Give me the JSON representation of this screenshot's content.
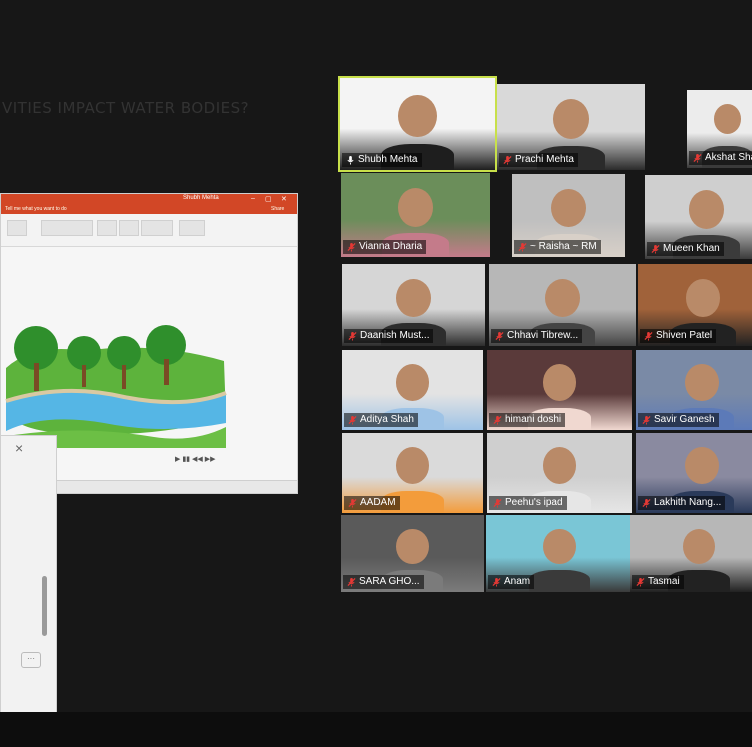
{
  "share": {
    "window_user": "Shubh Mehta",
    "tell_me": "Tell me what you want to do",
    "share_label": "Share",
    "slide_title": "VITIES IMPACT WATER BODIES?"
  },
  "side_panel": {
    "close_icon": "×",
    "more_label": "···"
  },
  "gallery": {
    "participants": [
      {
        "name": "Shubh Mehta",
        "muted": false
      },
      {
        "name": "Prachi Mehta",
        "muted": true
      },
      {
        "name": "Akshat Shah",
        "muted": true
      },
      {
        "name": "Vianna Dharia",
        "muted": true
      },
      {
        "name": "~ Raisha ~ RM",
        "muted": true
      },
      {
        "name": "Mueen Khan",
        "muted": true
      },
      {
        "name": "Daanish Must...",
        "muted": true
      },
      {
        "name": "Chhavi Tibrew...",
        "muted": true
      },
      {
        "name": "Shiven Patel",
        "muted": true
      },
      {
        "name": "Aditya Shah",
        "muted": true
      },
      {
        "name": "himani doshi",
        "muted": true
      },
      {
        "name": "Savir Ganesh",
        "muted": true
      },
      {
        "name": "AADAM",
        "muted": true
      },
      {
        "name": "Peehu's ipad",
        "muted": true
      },
      {
        "name": "Lakhith Nang...",
        "muted": true
      },
      {
        "name": "SARA GHO...",
        "muted": true
      },
      {
        "name": "Anam",
        "muted": true
      },
      {
        "name": "Tasmai",
        "muted": true
      }
    ]
  },
  "colors": {
    "active_speaker": "#c8e04a",
    "ppt_accent": "#d24726",
    "muted_mic": "#e53935"
  }
}
